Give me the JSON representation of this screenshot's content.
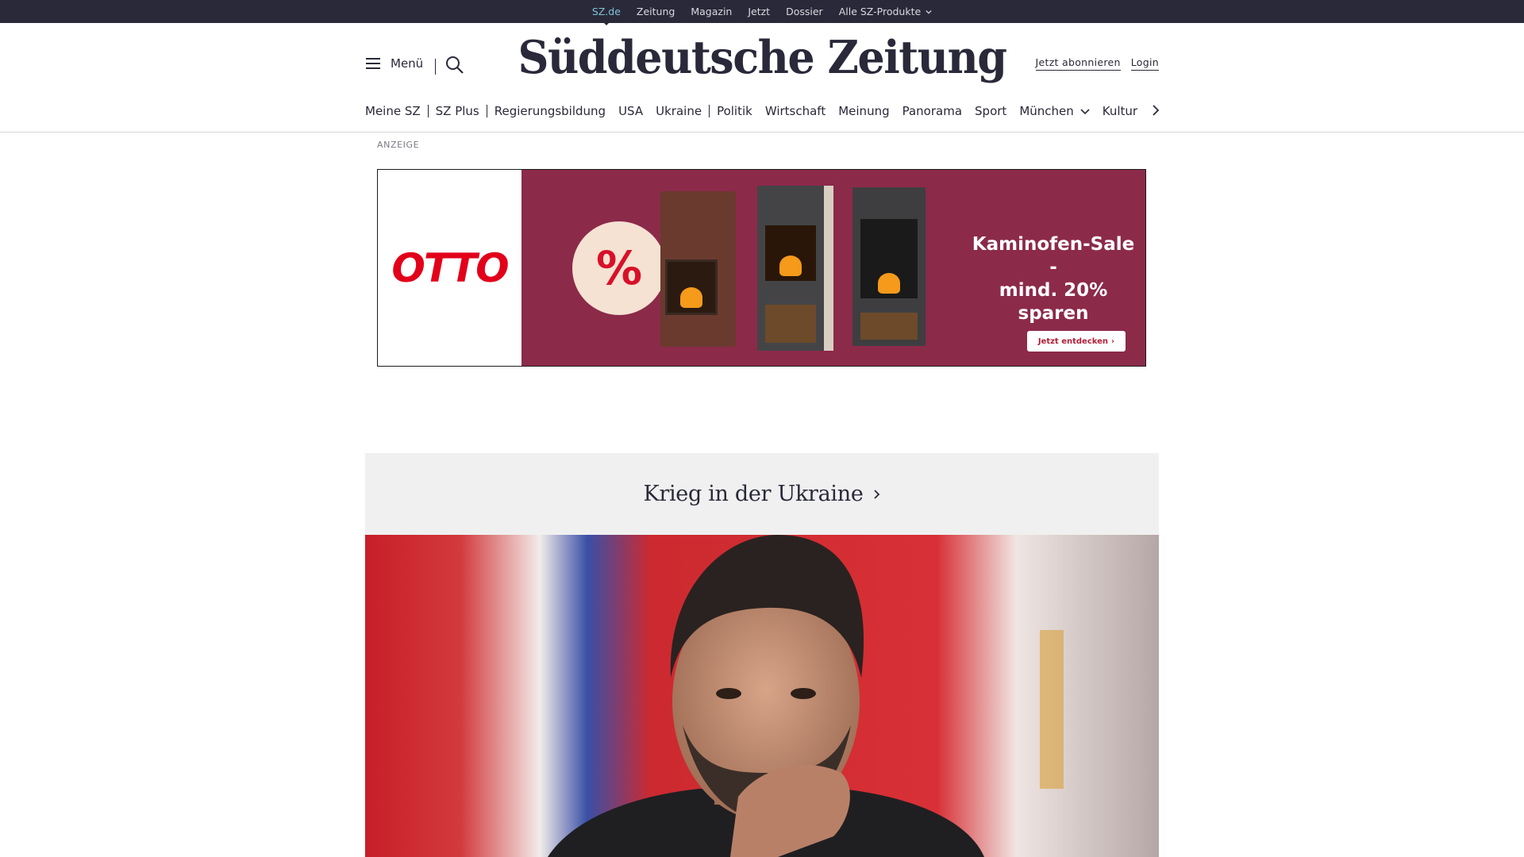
{
  "topbar": {
    "links": [
      "SZ.de",
      "Zeitung",
      "Magazin",
      "Jetzt",
      "Dossier",
      "Alle SZ-Produkte"
    ]
  },
  "header": {
    "menu_label": "Menü",
    "logo_text": "Süddeutsche Zeitung",
    "subscribe_label": "Jetzt abonnieren",
    "login_label": "Login"
  },
  "nav": {
    "items": [
      "Meine SZ",
      "SZ Plus",
      "Regierungsbildung",
      "USA",
      "Ukraine",
      "Politik",
      "Wirtschaft",
      "Meinung",
      "Panorama",
      "Sport",
      "München",
      "Kultur"
    ]
  },
  "ad": {
    "label": "ANZEIGE",
    "brand": "OTTO",
    "badge": "%",
    "headline_line1": "Kaminofen-Sale -",
    "headline_line2": "mind. 20% sparen",
    "cta": "Jetzt entdecken"
  },
  "section": {
    "title": "Krieg in der Ukraine"
  },
  "colors": {
    "topbar_bg": "#29293a",
    "topbar_active": "#7fc5d4",
    "text": "#29293a",
    "ad_bg": "#8c2a4a",
    "otto_red": "#e2001a",
    "section_bg": "#f0f0f0"
  },
  "icons": {
    "menu": "hamburger-icon",
    "search": "search-icon",
    "dropdown": "chevron-down-icon",
    "next": "chevron-right-icon"
  }
}
